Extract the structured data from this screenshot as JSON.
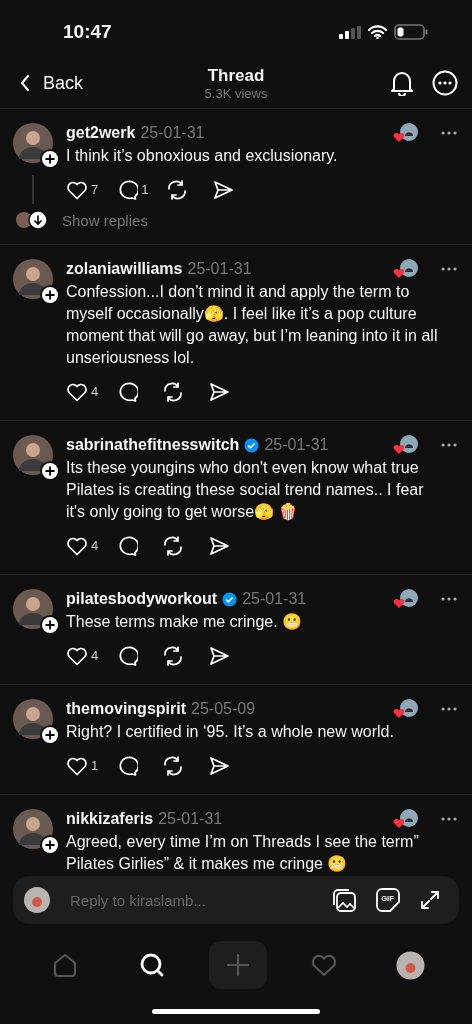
{
  "status_bar": {
    "time": "10:47"
  },
  "header": {
    "back": "Back",
    "title": "Thread",
    "subtitle": "5.3K views"
  },
  "posts": [
    {
      "username": "get2werk",
      "verified": false,
      "date": "25-01-31",
      "body": "I think it’s obnoxious and exclusionary.",
      "actions": {
        "likes": "7",
        "replies": "1"
      },
      "show_replies": "Show replies"
    },
    {
      "username": "zolaniawilliams",
      "verified": false,
      "date": "25-01-31",
      "body": "Confession...I don’t mind it and apply the term to myself occasionally🫣. I feel like it’s a pop culture moment that will go away, but I’m leaning into it in all unseriousness lol.",
      "actions": {
        "likes": "4"
      }
    },
    {
      "username": "sabrinathefitnesswitch",
      "verified": true,
      "date": "25-01-31",
      "body": "Its these youngins who don't even know what true Pilates is creating these social trend names.. I fear it's only going to get worse🫣 🍿",
      "actions": {
        "likes": "4"
      }
    },
    {
      "username": "pilatesbodyworkout",
      "verified": true,
      "date": "25-01-31",
      "body": "These terms make me cringe. 😬",
      "actions": {
        "likes": "4"
      }
    },
    {
      "username": "themovingspirit",
      "verified": false,
      "date": "25-05-09",
      "body": "Right? I certified in ‘95. It’s a whole new world.",
      "actions": {
        "likes": "1"
      }
    },
    {
      "username": "nikkizaferis",
      "verified": false,
      "date": "25-01-31",
      "body": "Agreed, every time I’m on Threads I see the term” Pilates Girlies” & it makes me cringe 😬"
    }
  ],
  "composer": {
    "placeholder": "Reply to kiraslamb...",
    "gif_label": "GIF"
  },
  "nav": [
    {
      "kind": "home",
      "selected": false
    },
    {
      "kind": "search",
      "selected": true
    },
    {
      "kind": "create",
      "selected": false
    },
    {
      "kind": "activity",
      "selected": false
    },
    {
      "kind": "profile",
      "selected": false
    }
  ]
}
